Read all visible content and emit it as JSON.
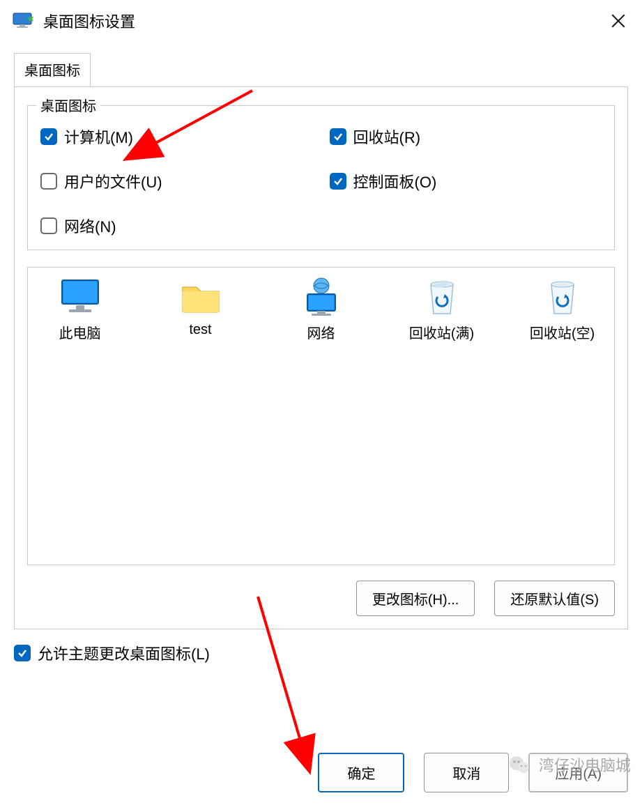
{
  "titlebar": {
    "title": "桌面图标设置"
  },
  "tabs": {
    "active": "桌面图标"
  },
  "group": {
    "legend": "桌面图标",
    "items": [
      {
        "label": "计算机(M)",
        "checked": true
      },
      {
        "label": "回收站(R)",
        "checked": true
      },
      {
        "label": "用户的文件(U)",
        "checked": false
      },
      {
        "label": "控制面板(O)",
        "checked": true
      },
      {
        "label": "网络(N)",
        "checked": false
      }
    ]
  },
  "previews": [
    {
      "label": "此电脑",
      "icon": "pc"
    },
    {
      "label": "test",
      "icon": "folder"
    },
    {
      "label": "网络",
      "icon": "network"
    },
    {
      "label": "回收站(满)",
      "icon": "bin-full"
    },
    {
      "label": "回收站(空)",
      "icon": "bin-empty"
    }
  ],
  "buttons": {
    "change_icon": "更改图标(H)...",
    "restore_defaults": "还原默认值(S)"
  },
  "theme_check": {
    "label": "允许主题更改桌面图标(L)",
    "checked": true
  },
  "footer": {
    "ok": "确定",
    "cancel": "取消",
    "apply": "应用(A)"
  },
  "watermark": {
    "text": "湾仔沙电脑城"
  }
}
